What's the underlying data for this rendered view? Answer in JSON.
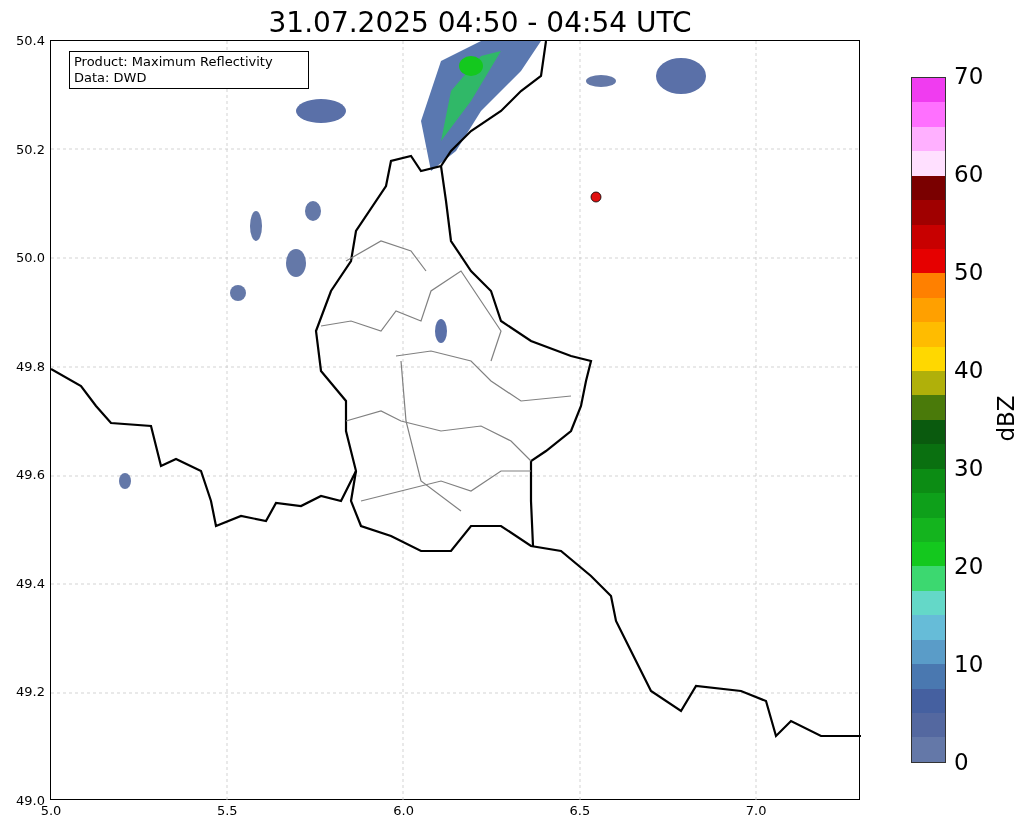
{
  "title": "31.07.2025 04:50 - 04:54 UTC",
  "legend": {
    "lines": [
      "Product: Maximum Reflectivity",
      "Data: DWD"
    ]
  },
  "x_ticks": [
    "5.0",
    "5.5",
    "6.0",
    "6.5",
    "7.0"
  ],
  "y_ticks": [
    "50.4",
    "50.2",
    "50.0",
    "49.8",
    "49.6",
    "49.4",
    "49.2",
    "49.0"
  ],
  "colorbar": {
    "label": "dBZ",
    "ticks": [
      "70",
      "60",
      "50",
      "40",
      "30",
      "20",
      "10",
      "0"
    ],
    "bins": [
      {
        "color": "#f03cf0"
      },
      {
        "color": "#ff70ff"
      },
      {
        "color": "#ffb0ff"
      },
      {
        "color": "#ffe0ff"
      },
      {
        "color": "#7a0000"
      },
      {
        "color": "#a00000"
      },
      {
        "color": "#c80000"
      },
      {
        "color": "#e60000"
      },
      {
        "color": "#ff8000"
      },
      {
        "color": "#ffa000"
      },
      {
        "color": "#ffbc00"
      },
      {
        "color": "#ffd800"
      },
      {
        "color": "#b0b00a"
      },
      {
        "color": "#4a7a0a"
      },
      {
        "color": "#0a5a0e"
      },
      {
        "color": "#0a7010"
      },
      {
        "color": "#0c8c14"
      },
      {
        "color": "#0ea01a"
      },
      {
        "color": "#14b41e"
      },
      {
        "color": "#14c81e"
      },
      {
        "color": "#3cd870"
      },
      {
        "color": "#64d8c8"
      },
      {
        "color": "#66bcd8"
      },
      {
        "color": "#5a9cc8"
      },
      {
        "color": "#4a78b0"
      },
      {
        "color": "#4560a0"
      },
      {
        "color": "#5468a0"
      },
      {
        "color": "#6478a8"
      }
    ]
  }
}
